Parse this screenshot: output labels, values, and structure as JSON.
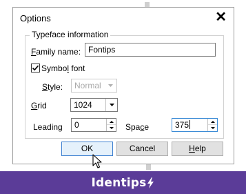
{
  "dialog": {
    "title": "Options",
    "close_glyph": "✕",
    "group_label": "Typeface information",
    "family_name": {
      "label": "Family name:",
      "value": "Fontips"
    },
    "symbol_font": {
      "label": "Symbol font",
      "checked": true
    },
    "style": {
      "label": "Style:",
      "value": "Normal",
      "enabled": false
    },
    "grid": {
      "label": "Grid",
      "value": "1024"
    },
    "leading": {
      "label": "Leading",
      "value": "0"
    },
    "space": {
      "label": "Space",
      "value": "375"
    },
    "buttons": {
      "ok": "OK",
      "cancel": "Cancel",
      "help": "Help"
    }
  },
  "brand": {
    "name": "Identips",
    "color": "#5b3c98",
    "icon": "lightning-bolt-icon"
  }
}
